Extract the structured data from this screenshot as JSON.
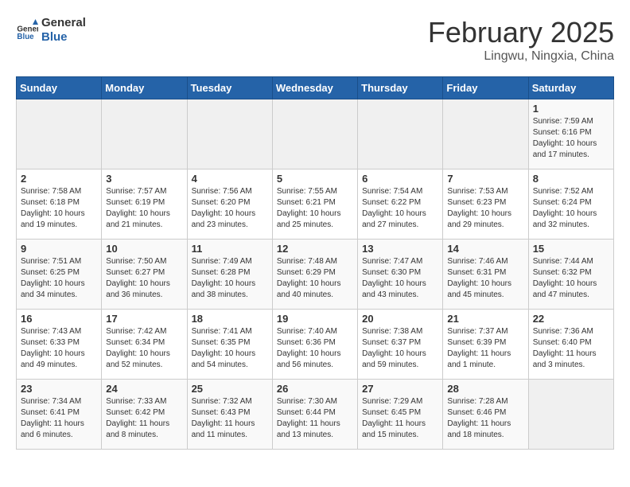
{
  "header": {
    "logo_line1": "General",
    "logo_line2": "Blue",
    "title": "February 2025",
    "subtitle": "Lingwu, Ningxia, China"
  },
  "weekdays": [
    "Sunday",
    "Monday",
    "Tuesday",
    "Wednesday",
    "Thursday",
    "Friday",
    "Saturday"
  ],
  "weeks": [
    [
      {
        "day": "",
        "info": ""
      },
      {
        "day": "",
        "info": ""
      },
      {
        "day": "",
        "info": ""
      },
      {
        "day": "",
        "info": ""
      },
      {
        "day": "",
        "info": ""
      },
      {
        "day": "",
        "info": ""
      },
      {
        "day": "1",
        "info": "Sunrise: 7:59 AM\nSunset: 6:16 PM\nDaylight: 10 hours\nand 17 minutes."
      }
    ],
    [
      {
        "day": "2",
        "info": "Sunrise: 7:58 AM\nSunset: 6:18 PM\nDaylight: 10 hours\nand 19 minutes."
      },
      {
        "day": "3",
        "info": "Sunrise: 7:57 AM\nSunset: 6:19 PM\nDaylight: 10 hours\nand 21 minutes."
      },
      {
        "day": "4",
        "info": "Sunrise: 7:56 AM\nSunset: 6:20 PM\nDaylight: 10 hours\nand 23 minutes."
      },
      {
        "day": "5",
        "info": "Sunrise: 7:55 AM\nSunset: 6:21 PM\nDaylight: 10 hours\nand 25 minutes."
      },
      {
        "day": "6",
        "info": "Sunrise: 7:54 AM\nSunset: 6:22 PM\nDaylight: 10 hours\nand 27 minutes."
      },
      {
        "day": "7",
        "info": "Sunrise: 7:53 AM\nSunset: 6:23 PM\nDaylight: 10 hours\nand 29 minutes."
      },
      {
        "day": "8",
        "info": "Sunrise: 7:52 AM\nSunset: 6:24 PM\nDaylight: 10 hours\nand 32 minutes."
      }
    ],
    [
      {
        "day": "9",
        "info": "Sunrise: 7:51 AM\nSunset: 6:25 PM\nDaylight: 10 hours\nand 34 minutes."
      },
      {
        "day": "10",
        "info": "Sunrise: 7:50 AM\nSunset: 6:27 PM\nDaylight: 10 hours\nand 36 minutes."
      },
      {
        "day": "11",
        "info": "Sunrise: 7:49 AM\nSunset: 6:28 PM\nDaylight: 10 hours\nand 38 minutes."
      },
      {
        "day": "12",
        "info": "Sunrise: 7:48 AM\nSunset: 6:29 PM\nDaylight: 10 hours\nand 40 minutes."
      },
      {
        "day": "13",
        "info": "Sunrise: 7:47 AM\nSunset: 6:30 PM\nDaylight: 10 hours\nand 43 minutes."
      },
      {
        "day": "14",
        "info": "Sunrise: 7:46 AM\nSunset: 6:31 PM\nDaylight: 10 hours\nand 45 minutes."
      },
      {
        "day": "15",
        "info": "Sunrise: 7:44 AM\nSunset: 6:32 PM\nDaylight: 10 hours\nand 47 minutes."
      }
    ],
    [
      {
        "day": "16",
        "info": "Sunrise: 7:43 AM\nSunset: 6:33 PM\nDaylight: 10 hours\nand 49 minutes."
      },
      {
        "day": "17",
        "info": "Sunrise: 7:42 AM\nSunset: 6:34 PM\nDaylight: 10 hours\nand 52 minutes."
      },
      {
        "day": "18",
        "info": "Sunrise: 7:41 AM\nSunset: 6:35 PM\nDaylight: 10 hours\nand 54 minutes."
      },
      {
        "day": "19",
        "info": "Sunrise: 7:40 AM\nSunset: 6:36 PM\nDaylight: 10 hours\nand 56 minutes."
      },
      {
        "day": "20",
        "info": "Sunrise: 7:38 AM\nSunset: 6:37 PM\nDaylight: 10 hours\nand 59 minutes."
      },
      {
        "day": "21",
        "info": "Sunrise: 7:37 AM\nSunset: 6:39 PM\nDaylight: 11 hours\nand 1 minute."
      },
      {
        "day": "22",
        "info": "Sunrise: 7:36 AM\nSunset: 6:40 PM\nDaylight: 11 hours\nand 3 minutes."
      }
    ],
    [
      {
        "day": "23",
        "info": "Sunrise: 7:34 AM\nSunset: 6:41 PM\nDaylight: 11 hours\nand 6 minutes."
      },
      {
        "day": "24",
        "info": "Sunrise: 7:33 AM\nSunset: 6:42 PM\nDaylight: 11 hours\nand 8 minutes."
      },
      {
        "day": "25",
        "info": "Sunrise: 7:32 AM\nSunset: 6:43 PM\nDaylight: 11 hours\nand 11 minutes."
      },
      {
        "day": "26",
        "info": "Sunrise: 7:30 AM\nSunset: 6:44 PM\nDaylight: 11 hours\nand 13 minutes."
      },
      {
        "day": "27",
        "info": "Sunrise: 7:29 AM\nSunset: 6:45 PM\nDaylight: 11 hours\nand 15 minutes."
      },
      {
        "day": "28",
        "info": "Sunrise: 7:28 AM\nSunset: 6:46 PM\nDaylight: 11 hours\nand 18 minutes."
      },
      {
        "day": "",
        "info": ""
      }
    ]
  ]
}
